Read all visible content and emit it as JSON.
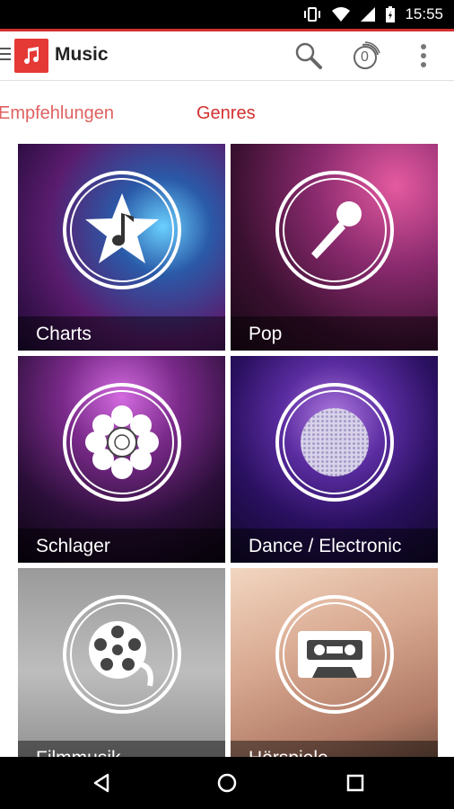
{
  "status_bar": {
    "time": "15:55"
  },
  "app_bar": {
    "title": "Music",
    "badge_count": "0"
  },
  "tabs": [
    {
      "label": "Empfehlungen",
      "active": false
    },
    {
      "label": "Genres",
      "active": true
    }
  ],
  "tiles": [
    {
      "label": "Charts",
      "icon": "star-music-note-icon"
    },
    {
      "label": "Pop",
      "icon": "microphone-icon"
    },
    {
      "label": "Schlager",
      "icon": "flower-icon"
    },
    {
      "label": "Dance / Electronic",
      "icon": "disco-ball-icon"
    },
    {
      "label": "Filmmusik",
      "icon": "film-reel-icon"
    },
    {
      "label": "Hörspiele",
      "icon": "cassette-icon"
    }
  ],
  "colors": {
    "accent": "#d32f2f",
    "tab_inactive": "#e06060"
  }
}
